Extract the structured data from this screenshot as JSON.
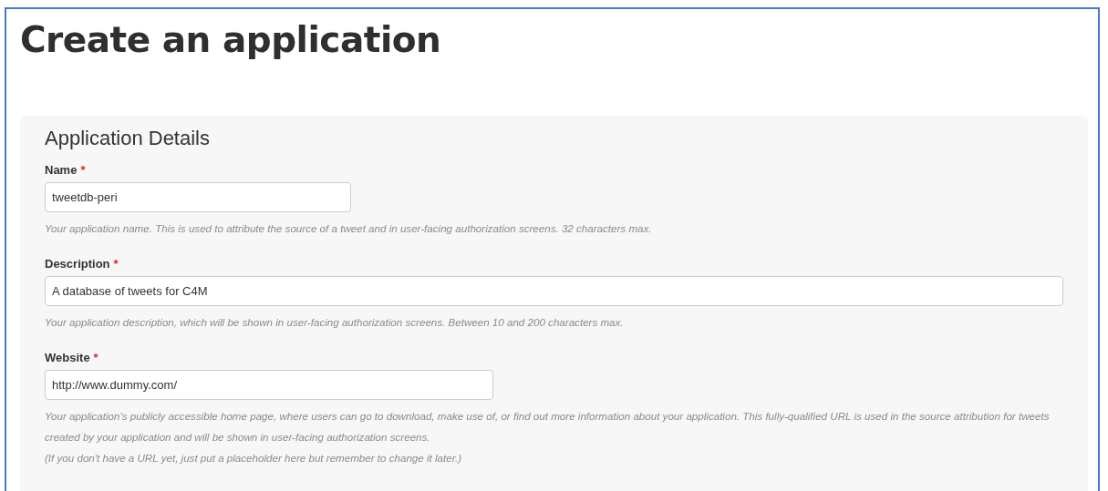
{
  "page": {
    "title": "Create an application"
  },
  "section": {
    "title": "Application Details",
    "fields": [
      {
        "label": "Name",
        "required_mark": "*",
        "value": "tweetdb-peri",
        "help": [
          "Your application name. This is used to attribute the source of a tweet and in user-facing authorization screens. 32 characters max."
        ]
      },
      {
        "label": "Description",
        "required_mark": "*",
        "value": "A database of tweets for C4M",
        "help": [
          "Your application description, which will be shown in user-facing authorization screens. Between 10 and 200 characters max."
        ]
      },
      {
        "label": "Website",
        "required_mark": "*",
        "value": "http://www.dummy.com/",
        "help": [
          "Your application's publicly accessible home page, where users can go to download, make use of, or find out more information about your application. This fully-qualified URL is used in the source attribution for tweets created by your application and will be shown in user-facing authorization screens.",
          "(If you don't have a URL yet, just put a placeholder here but remember to change it later.)"
        ]
      }
    ]
  }
}
